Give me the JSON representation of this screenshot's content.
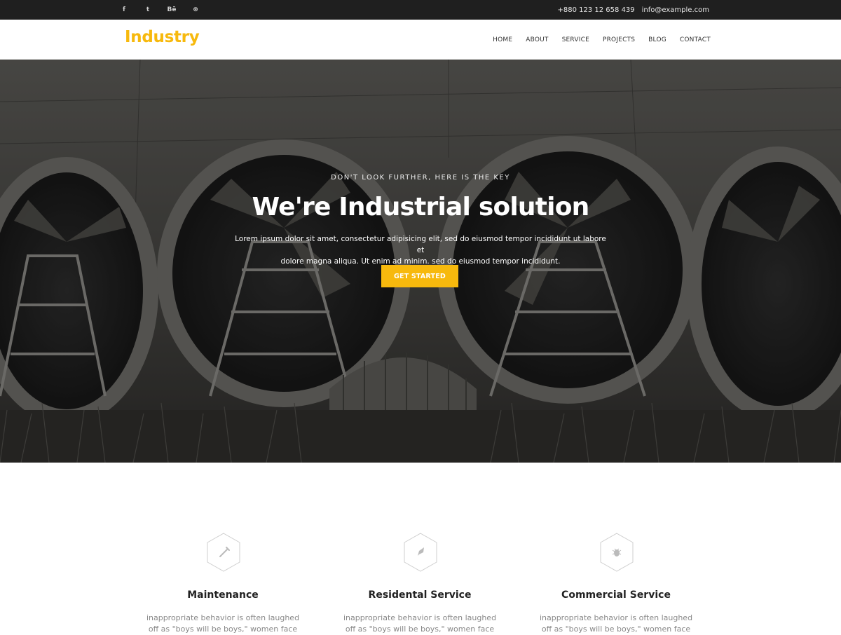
{
  "topbar": {
    "social": [
      {
        "name": "facebook-icon",
        "glyph": "f"
      },
      {
        "name": "twitter-icon",
        "glyph": "t"
      },
      {
        "name": "behance-icon",
        "glyph": "Bē"
      },
      {
        "name": "dribbble-icon",
        "glyph": "⊛"
      }
    ],
    "phone": "+880 123 12 658 439",
    "email": "info@example.com"
  },
  "header": {
    "logo": "Industry",
    "nav": [
      "HOME",
      "ABOUT",
      "SERVICE",
      "PROJECTS",
      "BLOG",
      "CONTACT"
    ]
  },
  "hero": {
    "kicker": "DON'T LOOK FURTHER, HERE IS THE KEY",
    "title": "We're Industrial solution",
    "description_line1": "Lorem ipsum dolor sit amet, consectetur adipisicing elit, sed do eiusmod tempor incididunt ut labore et",
    "description_line2": "dolore magna aliqua. Ut enim ad minim. sed do eiusmod tempor incididunt.",
    "cta": "GET STARTED"
  },
  "services": [
    {
      "title": "Maintenance",
      "icon": "wrench-icon",
      "text_line1": "inappropriate behavior is often laughed",
      "text_line2": "off as \"boys will be boys,\" women face"
    },
    {
      "title": "Residental Service",
      "icon": "rocket-icon",
      "text_line1": "inappropriate behavior is often laughed",
      "text_line2": "off as \"boys will be boys,\" women face"
    },
    {
      "title": "Commercial Service",
      "icon": "bug-icon",
      "text_line1": "inappropriate behavior is often laughed",
      "text_line2": "off as \"boys will be boys,\" women face"
    }
  ],
  "colors": {
    "accent": "#f7b90d",
    "topbar": "#1f1f1f"
  }
}
